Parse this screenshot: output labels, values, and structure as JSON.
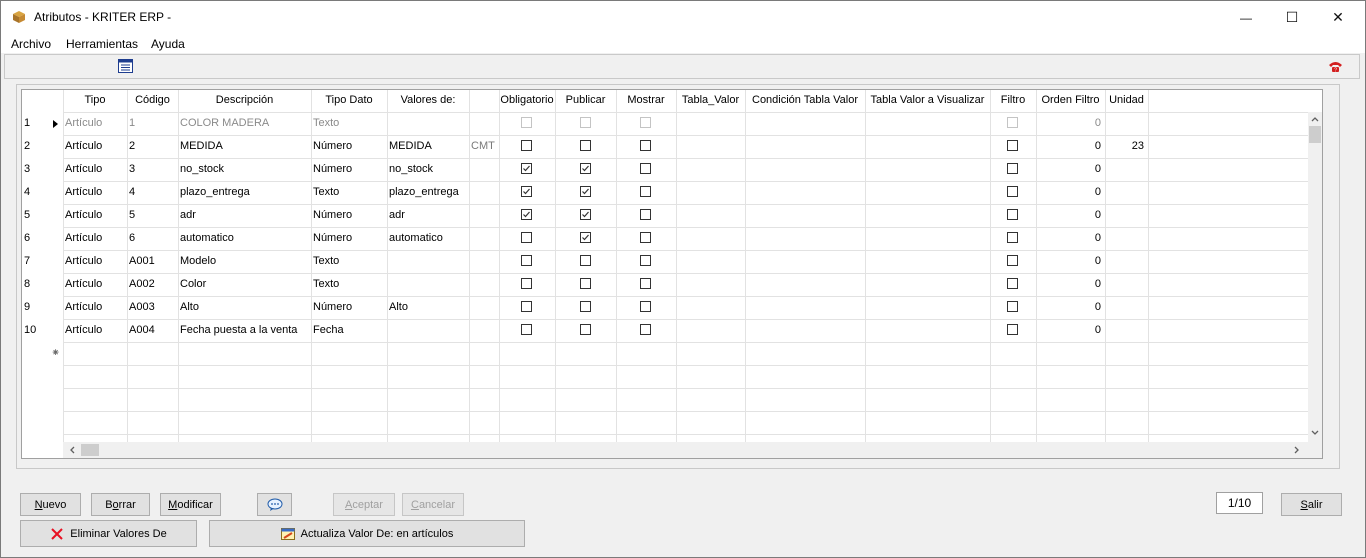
{
  "window": {
    "title": "Atributos - KRITER ERP -",
    "controls": {
      "minimize": "—",
      "maximize": "☐",
      "close": "✕"
    }
  },
  "menu": [
    "Archivo",
    "Herramientas",
    "Ayuda"
  ],
  "grid": {
    "columns": [
      "Tipo",
      "Código",
      "Descripción",
      "Tipo Dato",
      "Valores de:",
      "",
      "Obligatorio",
      "Publicar",
      "Mostrar",
      "Tabla_Valor",
      "Condición Tabla Valor",
      "Tabla Valor a Visualizar",
      "Filtro",
      "Orden Filtro",
      "Unidad"
    ],
    "rows": [
      {
        "num": "1",
        "tipo": "Artículo",
        "codigo": "1",
        "descripcion": "COLOR MADERA",
        "tipo_dato": "Texto",
        "valores_de": "",
        "extra": "",
        "obligatorio": false,
        "publicar": false,
        "mostrar": false,
        "filtro": false,
        "orden_filtro": "0",
        "unidad": "",
        "disabled": true,
        "current": true
      },
      {
        "num": "2",
        "tipo": "Artículo",
        "codigo": "2",
        "descripcion": "MEDIDA",
        "tipo_dato": "Número",
        "valores_de": "MEDIDA",
        "extra": "CMT",
        "obligatorio": false,
        "publicar": false,
        "mostrar": false,
        "filtro": false,
        "orden_filtro": "0",
        "unidad": "23",
        "disabled": false,
        "current": false
      },
      {
        "num": "3",
        "tipo": "Artículo",
        "codigo": "3",
        "descripcion": "no_stock",
        "tipo_dato": "Número",
        "valores_de": "no_stock",
        "extra": "",
        "obligatorio": true,
        "publicar": true,
        "mostrar": false,
        "filtro": false,
        "orden_filtro": "0",
        "unidad": "",
        "disabled": false,
        "current": false
      },
      {
        "num": "4",
        "tipo": "Artículo",
        "codigo": "4",
        "descripcion": "plazo_entrega",
        "tipo_dato": "Texto",
        "valores_de": "plazo_entrega",
        "extra": "",
        "obligatorio": true,
        "publicar": true,
        "mostrar": false,
        "filtro": false,
        "orden_filtro": "0",
        "unidad": "",
        "disabled": false,
        "current": false
      },
      {
        "num": "5",
        "tipo": "Artículo",
        "codigo": "5",
        "descripcion": "adr",
        "tipo_dato": "Número",
        "valores_de": "adr",
        "extra": "",
        "obligatorio": true,
        "publicar": true,
        "mostrar": false,
        "filtro": false,
        "orden_filtro": "0",
        "unidad": "",
        "disabled": false,
        "current": false
      },
      {
        "num": "6",
        "tipo": "Artículo",
        "codigo": "6",
        "descripcion": "automatico",
        "tipo_dato": "Número",
        "valores_de": "automatico",
        "extra": "",
        "obligatorio": false,
        "publicar": true,
        "mostrar": false,
        "filtro": false,
        "orden_filtro": "0",
        "unidad": "",
        "disabled": false,
        "current": false
      },
      {
        "num": "7",
        "tipo": "Artículo",
        "codigo": "A001",
        "descripcion": "Modelo",
        "tipo_dato": "Texto",
        "valores_de": "",
        "extra": "",
        "obligatorio": false,
        "publicar": false,
        "mostrar": false,
        "filtro": false,
        "orden_filtro": "0",
        "unidad": "",
        "disabled": false,
        "current": false
      },
      {
        "num": "8",
        "tipo": "Artículo",
        "codigo": "A002",
        "descripcion": "Color",
        "tipo_dato": "Texto",
        "valores_de": "",
        "extra": "",
        "obligatorio": false,
        "publicar": false,
        "mostrar": false,
        "filtro": false,
        "orden_filtro": "0",
        "unidad": "",
        "disabled": false,
        "current": false
      },
      {
        "num": "9",
        "tipo": "Artículo",
        "codigo": "A003",
        "descripcion": "Alto",
        "tipo_dato": "Número",
        "valores_de": "Alto",
        "extra": "",
        "obligatorio": false,
        "publicar": false,
        "mostrar": false,
        "filtro": false,
        "orden_filtro": "0",
        "unidad": "",
        "disabled": false,
        "current": false
      },
      {
        "num": "10",
        "tipo": "Artículo",
        "codigo": "A004",
        "descripcion": "Fecha puesta a la venta",
        "tipo_dato": "Fecha",
        "valores_de": "",
        "extra": "",
        "obligatorio": false,
        "publicar": false,
        "mostrar": false,
        "filtro": false,
        "orden_filtro": "0",
        "unidad": "",
        "disabled": false,
        "current": false
      }
    ],
    "new_row_marker": "⁕"
  },
  "buttons": {
    "nuevo": {
      "label": "Nuevo",
      "key": "N"
    },
    "borrar": {
      "label": "Borrar",
      "key": "o"
    },
    "modificar": {
      "label": "Modificar",
      "key": "M"
    },
    "aceptar": {
      "label": "Aceptar",
      "key": "A"
    },
    "cancelar": {
      "label": "Cancelar",
      "key": "C"
    },
    "salir": {
      "label": "Salir",
      "key": "S"
    },
    "eliminar_valores": "Eliminar Valores De",
    "actualiza_valor": "Actualiza Valor De: en artículos"
  },
  "record_counter": "1/10",
  "colors": {
    "checkmark": "#333333",
    "eliminar_x": "#e81123",
    "help_icon": "#d32020"
  }
}
